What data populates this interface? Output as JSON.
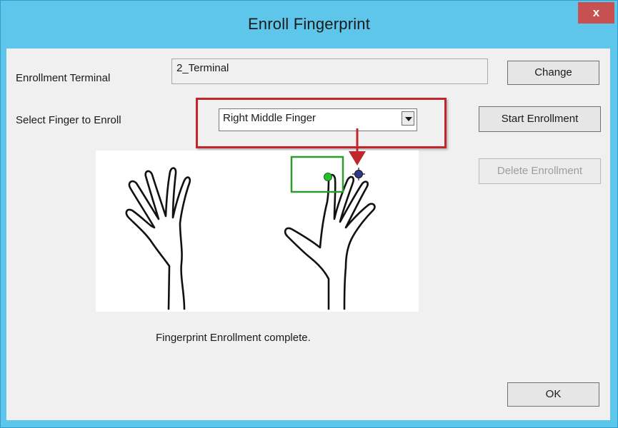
{
  "window": {
    "title": "Enroll Fingerprint",
    "close_label": "x"
  },
  "enrollment_terminal": {
    "label": "Enrollment Terminal",
    "value": "2_Terminal",
    "change_label": "Change"
  },
  "finger_select": {
    "label": "Select Finger to Enroll",
    "selected": "Right Middle Finger"
  },
  "buttons": {
    "start": "Start Enrollment",
    "delete": "Delete Enrollment",
    "ok": "OK"
  },
  "status": {
    "message": "Fingerprint Enrollment complete."
  },
  "colors": {
    "titlebar": "#5ec6ea",
    "close": "#c75050",
    "callout_red": "#c0272d",
    "finger_box_green": "#2e9b2e",
    "enrolled_dot": "#22c02a",
    "target_dot": "#2e3a8c"
  }
}
